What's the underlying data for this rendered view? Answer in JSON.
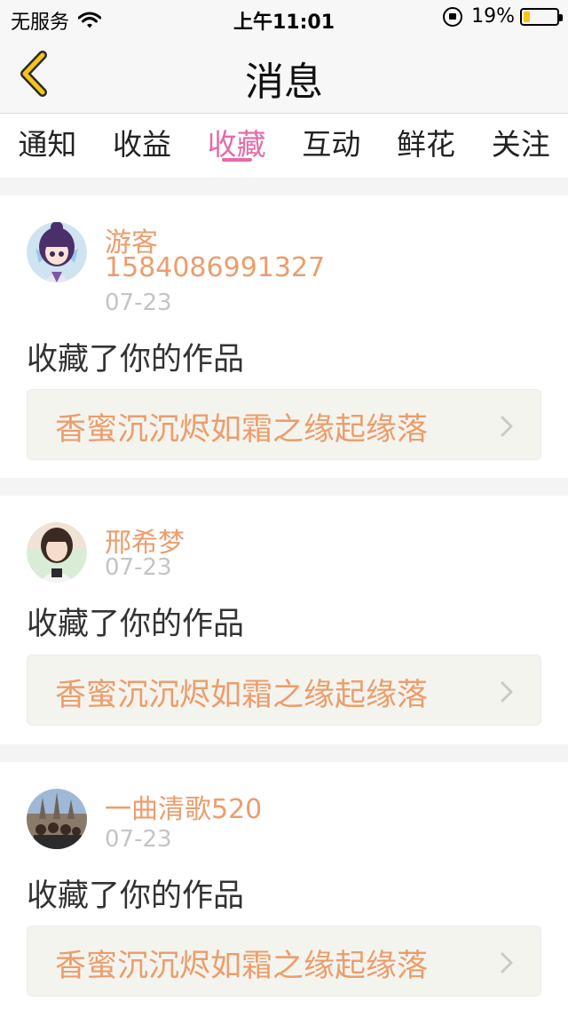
{
  "status_bar": {
    "carrier": "无服务",
    "time": "上午11:01",
    "battery": "19%",
    "battery_level": 0.19,
    "battery_color": "#f5c518"
  },
  "nav": {
    "title": "消息",
    "back_icon": "chevron-left-icon",
    "accent_color": "#f5c518"
  },
  "tabs": [
    {
      "label": "通知",
      "active": false
    },
    {
      "label": "收益",
      "active": false
    },
    {
      "label": "收藏",
      "active": true
    },
    {
      "label": "互动",
      "active": false
    },
    {
      "label": "鲜花",
      "active": false
    },
    {
      "label": "关注",
      "active": false
    }
  ],
  "active_tab_color": "#e46aa8",
  "messages": [
    {
      "user": "游客",
      "user_id": "1584086991327",
      "date": "07-23",
      "action": "收藏了你的作品",
      "work": "香蜜沉沉烬如霜之缘起缘落"
    },
    {
      "user": "邢希梦",
      "date": "07-23",
      "action": "收藏了你的作品",
      "work": "香蜜沉沉烬如霜之缘起缘落"
    },
    {
      "user": "一曲清歌520",
      "date": "07-23",
      "action": "收藏了你的作品",
      "work": "香蜜沉沉烬如霜之缘起缘落"
    }
  ],
  "name_color": "#ec9d6c"
}
